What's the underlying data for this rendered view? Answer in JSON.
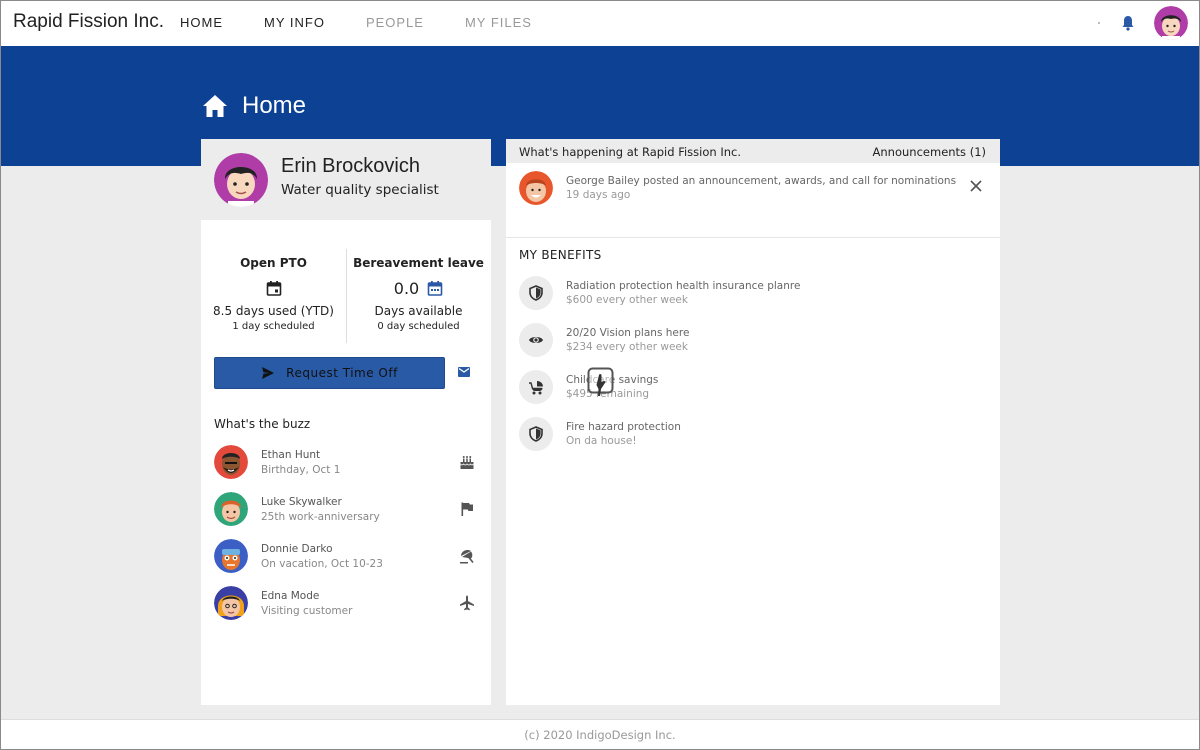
{
  "app": {
    "brand": "Rapid Fission Inc."
  },
  "nav": {
    "items": [
      {
        "label": "HOME",
        "state": "active"
      },
      {
        "label": "MY INFO",
        "state": "hover"
      },
      {
        "label": "PEOPLE",
        "state": "normal"
      },
      {
        "label": "MY FILES",
        "state": "normal"
      }
    ]
  },
  "page": {
    "title": "Home"
  },
  "colors": {
    "banner": "#0c4193",
    "primary_button": "#295aa6",
    "icon_blue": "#2a5aa6"
  },
  "profile": {
    "name": "Erin Brockovich",
    "role": "Water quality specialist"
  },
  "pto": {
    "open": {
      "title": "Open PTO",
      "used": "8.5 days used (YTD)",
      "scheduled": "1 day scheduled"
    },
    "bereavement": {
      "title": "Bereavement leave",
      "value": "0.0",
      "available": "Days available",
      "scheduled": "0 day scheduled"
    }
  },
  "actions": {
    "request_time_off": "Request Time Off"
  },
  "buzz": {
    "title": "What's the buzz",
    "items": [
      {
        "name": "Ethan Hunt",
        "detail": "Birthday, Oct 1",
        "icon": "cake-icon"
      },
      {
        "name": "Luke Skywalker",
        "detail": "25th work-anniversary",
        "icon": "flag-icon"
      },
      {
        "name": "Donnie Darko",
        "detail": "On vacation, Oct 10-23",
        "icon": "beach-umbrella-icon"
      },
      {
        "name": "Edna Mode",
        "detail": "Visiting customer",
        "icon": "airplane-icon"
      }
    ]
  },
  "happening": {
    "title": "What's happening at Rapid Fission Inc.",
    "announcements_label": "Announcements (1)",
    "announcement": {
      "text": "George Bailey posted an announcement, awards, and call for nominations",
      "time": "19 days ago"
    }
  },
  "benefits": {
    "title": "MY BENEFITS",
    "items": [
      {
        "name": "Radiation protection health insurance planre",
        "detail": "$600 every other week",
        "icon": "shield-icon"
      },
      {
        "name": "20/20 Vision plans here",
        "detail": "$234 every other week",
        "icon": "eye-icon"
      },
      {
        "name": "Childcare savings",
        "detail": "$495 remaining",
        "icon": "stroller-icon"
      },
      {
        "name": "Fire hazard protection",
        "detail": "On da house!",
        "icon": "shield-icon"
      }
    ]
  },
  "footer": {
    "text": "(c) 2020 IndigoDesign Inc."
  }
}
